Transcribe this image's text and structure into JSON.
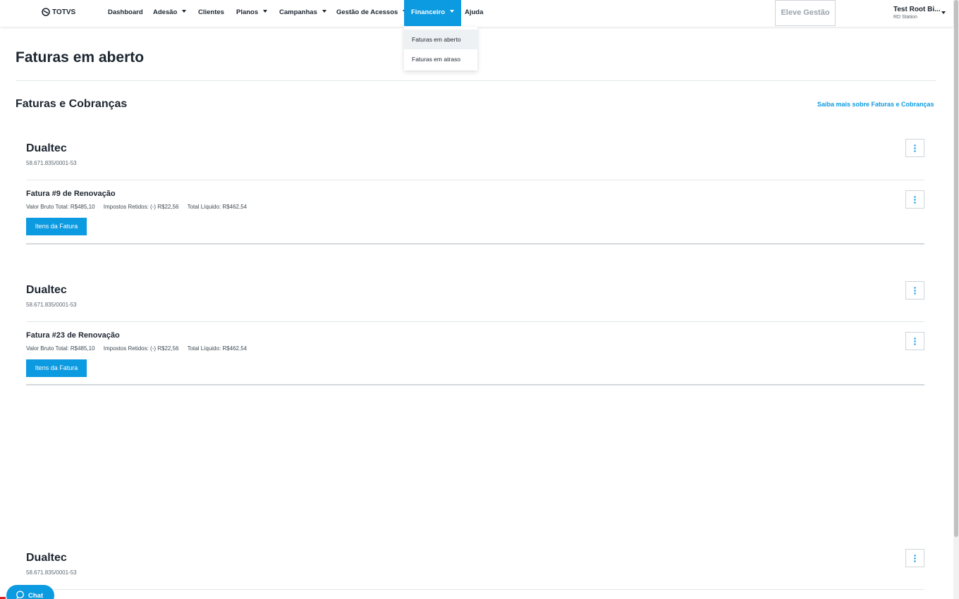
{
  "brand": {
    "name": "TOTVS",
    "icon": "totvs-logo-icon"
  },
  "nav": {
    "items": [
      {
        "label": "Dashboard",
        "has_caret": false
      },
      {
        "label": "Adesão",
        "has_caret": true
      },
      {
        "label": "Clientes",
        "has_caret": false
      },
      {
        "label": "Planos",
        "has_caret": true
      },
      {
        "label": "Campanhas",
        "has_caret": true
      },
      {
        "label": "Gestão de Acessos",
        "has_caret": true
      },
      {
        "label": "Financeiro",
        "has_caret": true,
        "active": true
      },
      {
        "label": "Ajuda",
        "has_caret": false
      }
    ],
    "cta_label": "Eleve Gestão",
    "user_name": "Test Root Bi...",
    "user_org": "RD Station",
    "active_color": "#0c9ae0"
  },
  "dropdown": {
    "items": [
      {
        "label": "Faturas em aberto",
        "highlighted": true
      },
      {
        "label": "Faturas em atraso",
        "highlighted": false
      }
    ]
  },
  "page": {
    "title": "Faturas em aberto",
    "section_title": "Faturas e Cobranças",
    "learn_more_link": "Saiba mais sobre Faturas e Cobranças"
  },
  "clients": [
    {
      "name": "Dualtec",
      "document": "58.671.835/0001-53",
      "invoice": {
        "title": "Fatura #9 de Renovação",
        "gross": "Valor Bruto Total: R$485,10",
        "taxes": "Impostos Retidos: (-) R$22,56",
        "net": "Total Líquido: R$462,54",
        "items_button": "Itens da Fatura"
      }
    },
    {
      "name": "Dualtec",
      "document": "58.671.835/0001-53",
      "invoice": {
        "title": "Fatura #23 de Renovação",
        "gross": "Valor Bruto Total: R$485,10",
        "taxes": "Impostos Retidos: (-) R$22,56",
        "net": "Total Líquido: R$462,54",
        "items_button": "Itens da Fatura"
      }
    },
    {
      "name": "Dualtec",
      "document": "58.671.835/0001-53"
    }
  ],
  "chat": {
    "label": "Chat",
    "icon": "chat-bubble-icon"
  }
}
